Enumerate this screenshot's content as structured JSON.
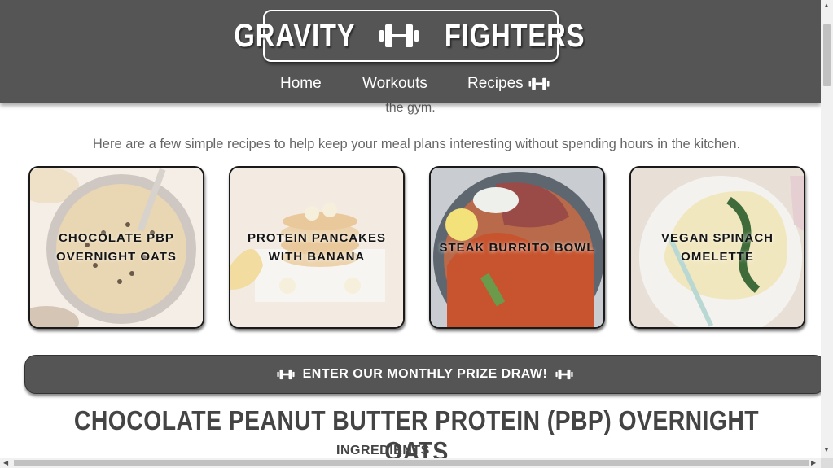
{
  "header": {
    "logo_left": "GRAVITY",
    "logo_right": "FIGHTERS",
    "logo_icon": "dumbbell-icon",
    "nav": [
      {
        "label": "Home"
      },
      {
        "label": "Workouts"
      },
      {
        "label": "Recipes",
        "icon": "dumbbell-icon"
      }
    ]
  },
  "main": {
    "intro_tail": "the gym.",
    "intro": "Here are a few simple recipes to help keep your meal plans interesting without spending hours in the kitchen.",
    "cards": [
      {
        "title": "CHOCOLATE PBP OVERNIGHT OATS"
      },
      {
        "title": "PROTEIN PANCAKES WITH BANANA"
      },
      {
        "title": "STEAK BURRITO BOWL"
      },
      {
        "title": "VEGAN SPINACH OMELETTE"
      }
    ],
    "prize_button": "ENTER OUR MONTHLY PRIZE DRAW!",
    "recipe_heading": "CHOCOLATE PEANUT BUTTER PROTEIN (PBP) OVERNIGHT OATS",
    "ingredients_heading": "INGREDIENTS"
  },
  "colors": {
    "header_bg": "#555555",
    "text": "#666666",
    "card_border": "#1a1a1a"
  }
}
